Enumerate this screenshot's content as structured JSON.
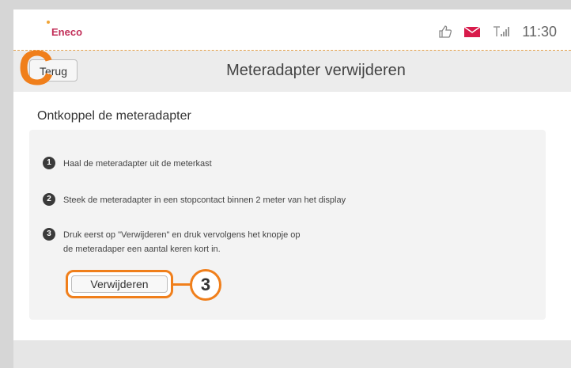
{
  "status": {
    "brand": "Eneco",
    "time": "11:30",
    "icons": [
      "thumbs-up-icon",
      "mail-icon",
      "signal-icon"
    ],
    "colors": {
      "brand": "#c22f59",
      "accent": "#f07f1b",
      "mail": "#d81b4b"
    }
  },
  "header": {
    "back_label": "Terug",
    "title": "Meteradapter verwijderen"
  },
  "overlay": {
    "marker_letter": "C",
    "callout_number": "3"
  },
  "main": {
    "section_title": "Ontkoppel de meteradapter",
    "steps": [
      {
        "num": "1",
        "text": "Haal de meteradapter uit de meterkast"
      },
      {
        "num": "2",
        "text": "Steek de meteradapter in een stopcontact binnen 2 meter van het display"
      },
      {
        "num": "3",
        "line1": "Druk eerst op \"Verwijderen\" en druk vervolgens het knopje op",
        "line2": "de meteradaper een aantal keren kort in."
      }
    ],
    "remove_label": "Verwijderen"
  }
}
